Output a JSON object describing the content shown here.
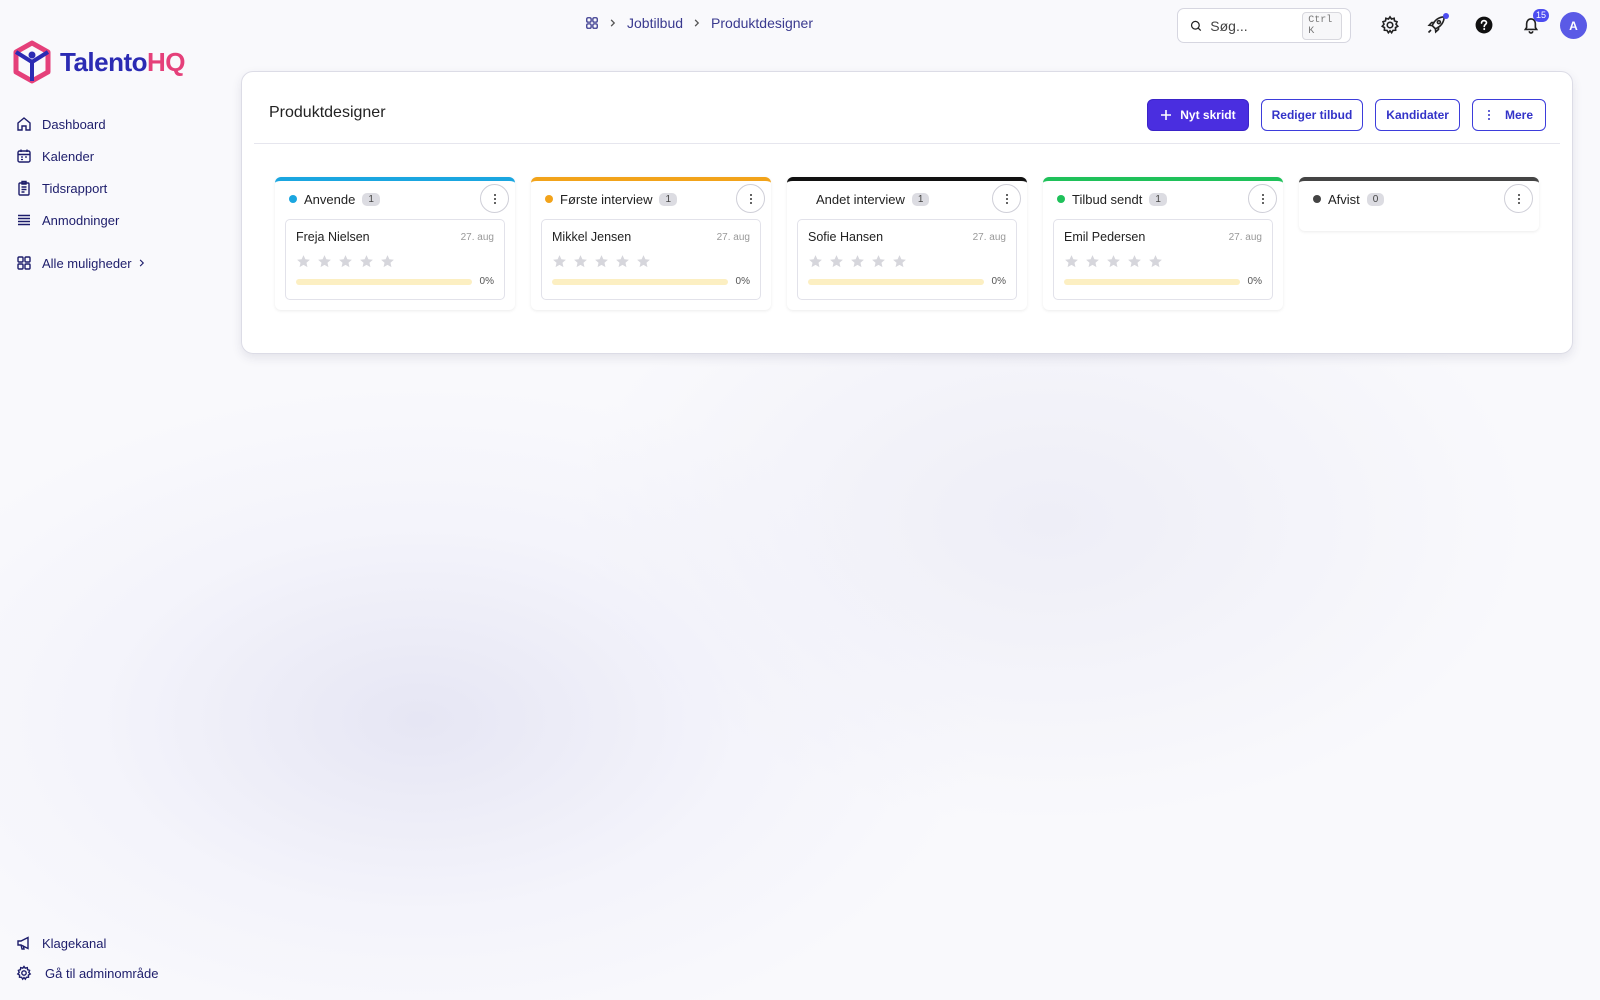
{
  "brand": {
    "name_part1": "Talento",
    "name_part2": "HQ"
  },
  "sidebar": {
    "items": [
      {
        "label": "Dashboard",
        "icon": "home-icon"
      },
      {
        "label": "Kalender",
        "icon": "calendar-icon"
      },
      {
        "label": "Tidsrapport",
        "icon": "timesheet-icon"
      },
      {
        "label": "Anmodninger",
        "icon": "stack-icon"
      }
    ],
    "all_options": "Alle muligheder",
    "bottom": [
      {
        "label": "Klagekanal",
        "icon": "megaphone-icon"
      },
      {
        "label": "Gå til adminområde",
        "icon": "gear-icon"
      }
    ]
  },
  "breadcrumb": {
    "items": [
      "Jobtilbud",
      "Produktdesigner"
    ]
  },
  "search": {
    "placeholder": "Søg...",
    "shortcut": "Ctrl K"
  },
  "notifications": {
    "count": "15"
  },
  "user": {
    "initial": "A"
  },
  "page": {
    "title": "Produktdesigner",
    "actions": {
      "new_step": "Nyt skridt",
      "edit_offer": "Rediger tilbud",
      "candidates": "Kandidater",
      "more": "Mere"
    }
  },
  "colors": {
    "primary": "#4a2ee0",
    "stage_apply": "#1aa6e0",
    "stage_first": "#f2a31a",
    "stage_second": "#111111",
    "stage_offer": "#1fc15a",
    "stage_rejected": "#444444"
  },
  "pipeline": [
    {
      "title": "Anvende",
      "count": "1",
      "color": "#1aa6e0",
      "dot": "#1aa6e0",
      "candidate": {
        "name": "Freja Nielsen",
        "date": "27. aug",
        "rating": 0,
        "progress": 0,
        "progress_label": "0%"
      }
    },
    {
      "title": "Første interview",
      "count": "1",
      "color": "#f2a31a",
      "dot": "#f2a31a",
      "candidate": {
        "name": "Mikkel Jensen",
        "date": "27. aug",
        "rating": 0,
        "progress": 0,
        "progress_label": "0%"
      }
    },
    {
      "title": "Andet interview",
      "count": "1",
      "color": "#111111",
      "dot": "#ffffff",
      "candidate": {
        "name": "Sofie Hansen",
        "date": "27. aug",
        "rating": 0,
        "progress": 0,
        "progress_label": "0%"
      }
    },
    {
      "title": "Tilbud sendt",
      "count": "1",
      "color": "#1fc15a",
      "dot": "#1fc15a",
      "candidate": {
        "name": "Emil Pedersen",
        "date": "27. aug",
        "rating": 0,
        "progress": 0,
        "progress_label": "0%"
      }
    },
    {
      "title": "Afvist",
      "count": "0",
      "color": "#444444",
      "dot": "#444444",
      "candidate": null
    }
  ]
}
